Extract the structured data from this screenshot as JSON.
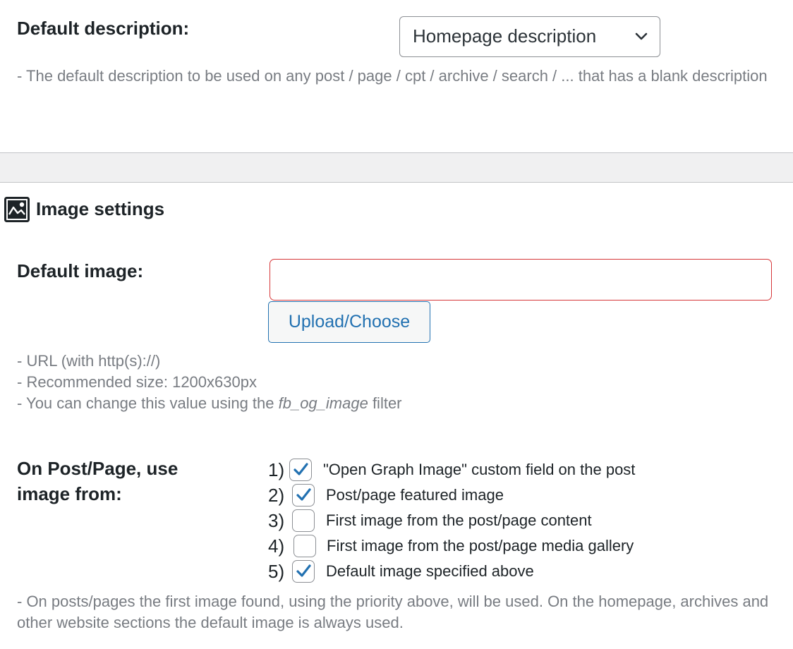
{
  "description": {
    "label": "Default description:",
    "select_value": "Homepage description",
    "help": "- The default description to be used on any post / page / cpt / archive / search / ... that has a blank description"
  },
  "image_section": {
    "title": "Image settings",
    "default_image": {
      "label": "Default image:",
      "value": "",
      "button_label": "Upload/Choose",
      "help_lines": [
        "- URL (with http(s)://)",
        "- Recommended size: 1200x630px"
      ],
      "help_filter_prefix": "- You can change this value using the ",
      "help_filter_name": "fb_og_image",
      "help_filter_suffix": " filter"
    },
    "use_image_from": {
      "label_line1": "On Post/Page, use",
      "label_line2": "image from:",
      "options": [
        {
          "num": "1)",
          "label": "\"Open Graph Image\" custom field on the post",
          "checked": true
        },
        {
          "num": "2)",
          "label": "Post/page featured image",
          "checked": true
        },
        {
          "num": "3)",
          "label": "First image from the post/page content",
          "checked": false
        },
        {
          "num": "4)",
          "label": "First image from the post/page media gallery",
          "checked": false
        },
        {
          "num": "5)",
          "label": "Default image specified above",
          "checked": true
        }
      ],
      "help": "- On posts/pages the first image found, using the priority above, will be used. On the homepage, archives and other website sections the default image is always used."
    }
  },
  "icons": {
    "section_icon": "image-icon",
    "select_icon": "chevron-down-icon",
    "check_icon": "checkmark-icon"
  },
  "colors": {
    "accent": "#2271b1",
    "error_border": "#d63638",
    "help_text": "#787c82"
  }
}
